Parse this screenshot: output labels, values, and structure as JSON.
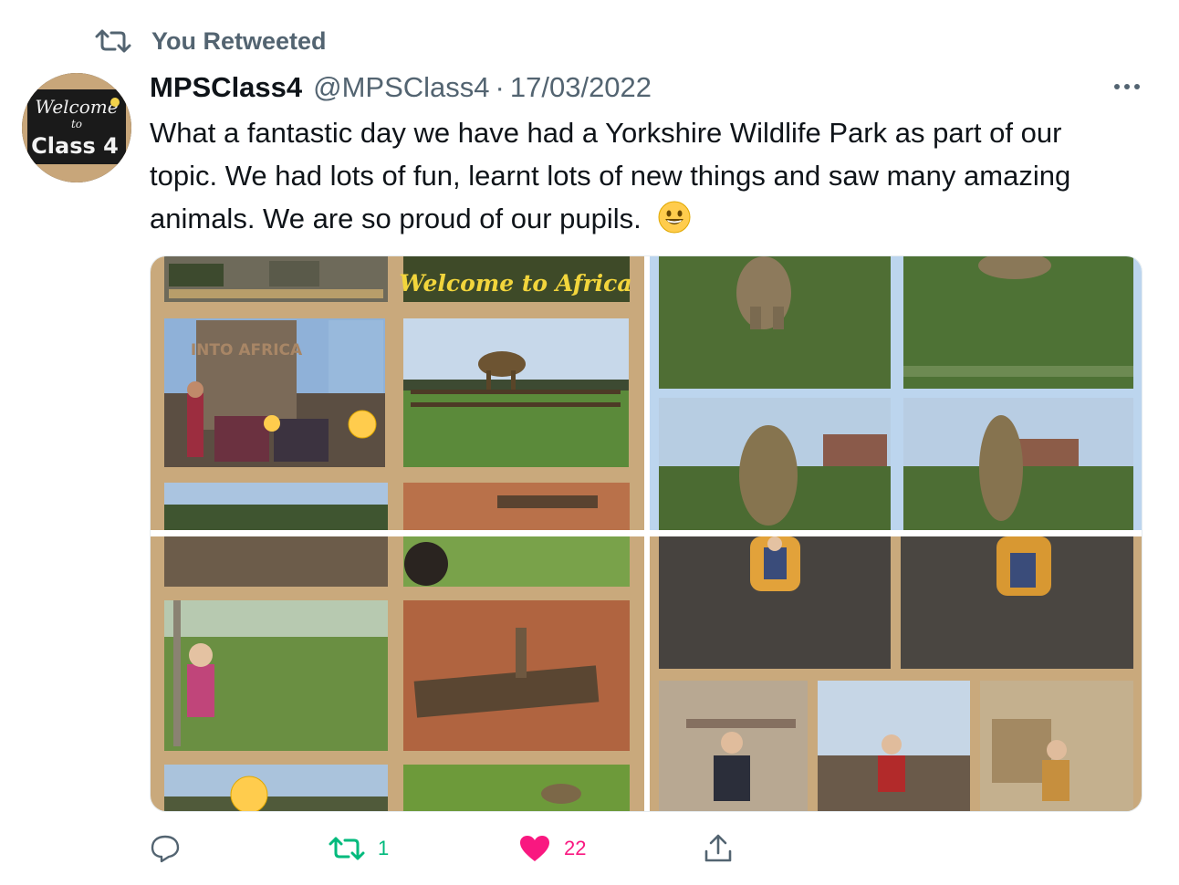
{
  "retweet_banner": {
    "label": "You Retweeted",
    "icon": "retweet-icon"
  },
  "tweet": {
    "display_name": "MPSClass4",
    "handle": "@MPSClass4",
    "separator": "·",
    "date": "17/03/2022",
    "text": "What a fantastic day we have had a Yorkshire Wildlife Park as part of our topic. We had lots of fun, learnt lots of new things and saw many amazing animals. We are so proud of our pupils.",
    "avatar": {
      "line1": "Welcome",
      "line2": "to",
      "line3": "Class 4"
    }
  },
  "media": {
    "collage1_banner": "Welcome to Africa",
    "collage1_sign": "INTO AFRICA"
  },
  "actions": {
    "reply": {
      "icon": "reply-icon",
      "count": ""
    },
    "retweet": {
      "icon": "retweet-icon",
      "count": "1",
      "color": "#00ba7c"
    },
    "like": {
      "icon": "heart-icon",
      "count": "22",
      "color": "#f91880"
    },
    "share": {
      "icon": "share-icon"
    }
  },
  "colors": {
    "secondary_text": "#536471",
    "primary_text": "#0f1419",
    "collage_bg": "#c9a97c"
  }
}
